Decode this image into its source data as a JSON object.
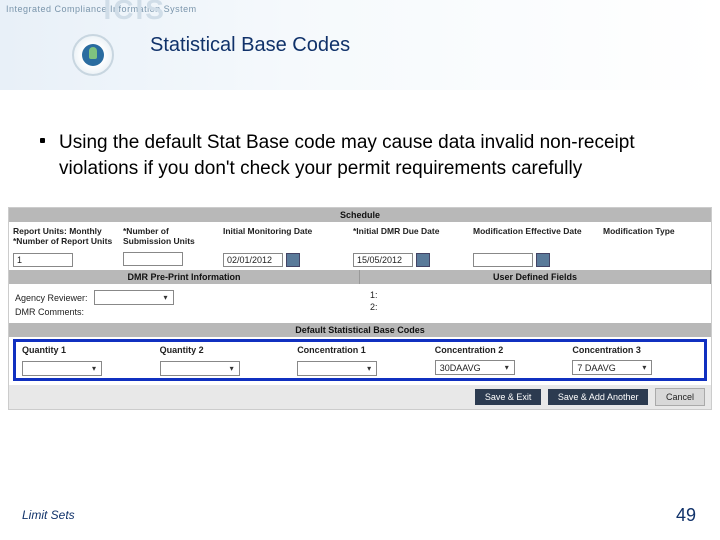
{
  "header": {
    "system_tag": "Integrated Compliance Information System",
    "system_abbrev": "ICIS",
    "title": "Statistical Base Codes"
  },
  "bullet": "Using the default Stat Base code may cause data invalid non-receipt violations if you don't check your permit requirements carefully",
  "schedule": {
    "band_label": "Schedule",
    "report_units_label": "Report Units: Monthly",
    "num_report_units_label": "*Number of Report Units",
    "num_report_units_value": "1",
    "num_submission_units_label": "*Number of Submission Units",
    "num_submission_units_value": "",
    "initial_monitoring_date_label": "Initial Monitoring Date",
    "initial_monitoring_date_value": "02/01/2012",
    "initial_dmr_due_date_label": "*Initial DMR Due Date",
    "initial_dmr_due_date_value": "15/05/2012",
    "mod_eff_date_label": "Modification Effective Date",
    "mod_type_label": "Modification Type"
  },
  "preprint": {
    "band_label": "DMR Pre-Print Information",
    "agency_reviewer_label": "Agency Reviewer:",
    "dmr_comments_label": "DMR Comments:"
  },
  "userdef": {
    "band_label": "User Defined Fields",
    "f1": "1:",
    "f2": "2:"
  },
  "dsbc": {
    "band_label": "Default Statistical Base Codes",
    "cols": [
      "Quantity 1",
      "Quantity 2",
      "Concentration 1",
      "Concentration 2",
      "Concentration 3"
    ],
    "values": [
      "",
      "",
      "",
      "30DAAVG",
      "7 DAAVG"
    ]
  },
  "buttons": {
    "save_exit": "Save & Exit",
    "save_add": "Save & Add Another",
    "cancel": "Cancel"
  },
  "footer": {
    "left": "Limit Sets",
    "page": "49"
  }
}
